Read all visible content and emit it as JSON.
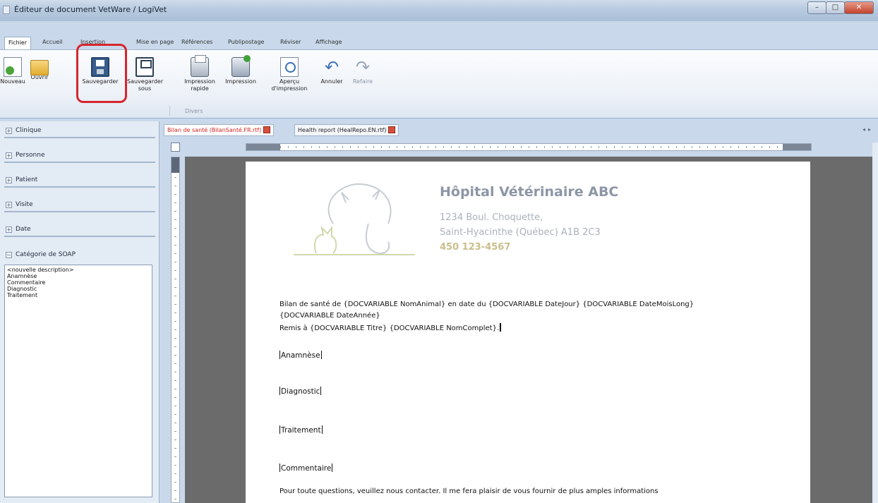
{
  "window": {
    "title": "Éditeur de document VetWare / LogiVet",
    "controls": [
      "minimize-icon",
      "maximize-icon",
      "close-icon"
    ]
  },
  "ribbon_tabs": [
    "Fichier",
    "Accueil",
    "Insertion",
    "Mise en page",
    "Références",
    "Publipostage",
    "Réviser",
    "Affichage"
  ],
  "ribbon": {
    "buttons": [
      {
        "label": "Nouveau",
        "icon": "new-document-icon"
      },
      {
        "label": "Ouvrir",
        "icon": "folder-open-icon"
      },
      {
        "label": "Sauvegarder",
        "icon": "save-icon"
      },
      {
        "label": "Sauvegarder sous",
        "label_line1": "Sauvegarder",
        "label_line2": "sous",
        "icon": "save-as-icon"
      },
      {
        "label": "Impression rapide",
        "label_line1": "Impression",
        "label_line2": "rapide",
        "icon": "quick-print-icon"
      },
      {
        "label": "Impression",
        "icon": "print-icon"
      },
      {
        "label": "Aperçu d'impression",
        "label_line1": "Aperçu",
        "label_line2": "d'impression",
        "icon": "print-preview-icon"
      },
      {
        "label": "Annuler",
        "icon": "undo-icon"
      },
      {
        "label": "Refaire",
        "icon": "redo-icon",
        "disabled": true
      }
    ],
    "group_label": "Divers",
    "highlight_color": "#d7262e"
  },
  "left_panel": {
    "sections": [
      "Clinique",
      "Personne",
      "Patient",
      "Visite",
      "Date"
    ],
    "soap": {
      "title": "Catégorie de SOAP",
      "items": [
        "<nouvelle description>",
        "Anamnèse",
        "Commentaire",
        "Diagnostic",
        "Traitement"
      ]
    }
  },
  "doc_tabs": [
    {
      "label": "Bilan de santé (BilanSanté.FR.rtf)",
      "active": true
    },
    {
      "label": "Health report (HealRepo.EN.rtf)",
      "active": false
    }
  ],
  "document": {
    "hospital_name": "Hôpital Vétérinaire ABC",
    "address_line1": "1234 Boul. Choquette,",
    "address_line2": "Saint-Hyacinthe (Québec)  A1B 2C3",
    "phone": "450 123-4567",
    "intro_line1": "Bilan de santé de {DOCVARIABLE NomAnimal} en date du {DOCVARIABLE DateJour} {DOCVARIABLE DateMoisLong}",
    "intro_line2": "{DOCVARIABLE DateAnnée}",
    "intro_line3": "Remis à {DOCVARIABLE Titre} {DOCVARIABLE NomComplet}.",
    "fields": [
      "Anamnèse",
      "Diagnostic",
      "Traitement",
      "Commentaire"
    ],
    "closing": "Pour toute questions, veuillez nous contacter. Il me fera plaisir de vous fournir de plus amples informations"
  },
  "colors": {
    "accent": "#3773b8",
    "logo_gray": "#b8bec8",
    "logo_green": "#c9d6a8",
    "phone_color": "#c9be8a"
  }
}
